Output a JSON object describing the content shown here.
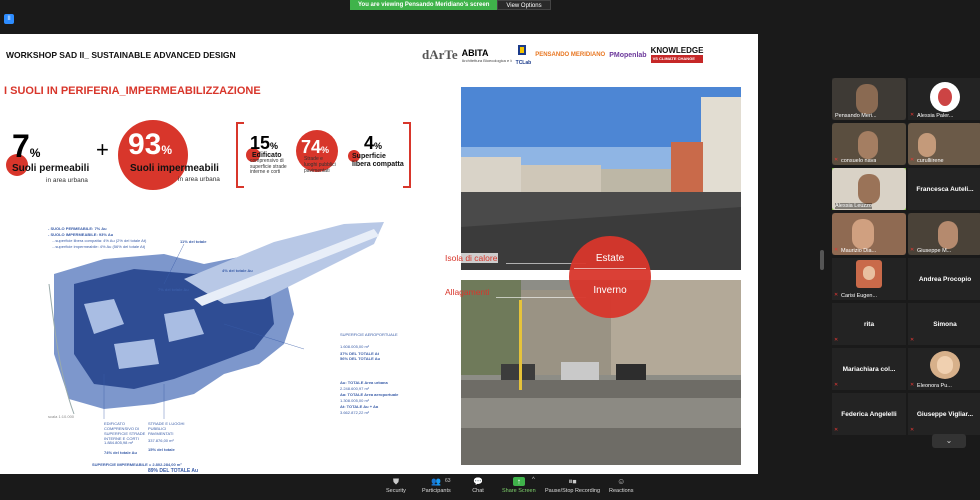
{
  "banner": {
    "viewing": "You are viewing Pensando Meridiano's screen",
    "view_options": "View Options"
  },
  "slide": {
    "workshop_title": "WORKSHOP SAD II_ SUSTAINABLE ADVANCED DESIGN",
    "logos": {
      "darte": "dArTe",
      "abita": "ABITA",
      "abita_sub": "Architettura Bioecologica e Innovazione Tecnologica per l'Ambiente",
      "tclab": "TCLab",
      "pensando": "PENSANDO MERIDIANO",
      "pmlab": "PMopenlab",
      "knowledge": "KNOWLEDGE",
      "knowledge_sub": "VS CLIMATE CHANGE"
    },
    "section_title": "I SUOLI IN PERIFERIA_IMPERMEABILIZZAZIONE",
    "stats": [
      {
        "value": "7",
        "unit": "%",
        "label": "Suoli permeabili",
        "sub": "in area urbana"
      },
      {
        "value": "93",
        "unit": "%",
        "label": "Suoli impermeabili",
        "sub": "in area urbana"
      },
      {
        "value": "15",
        "unit": "%",
        "label": "Edificato",
        "sub": "comprensivo di superficie strade interne e corti"
      },
      {
        "value": "74",
        "unit": "%",
        "label": "Strade e luoghi pubblici",
        "sub": "pavimentati"
      },
      {
        "value": "4",
        "unit": "%",
        "label": "Superficie",
        "sub": "libera compatta"
      }
    ],
    "plus": "+",
    "map_notes": {
      "permeabile": "- SUOLO PERMEABILE: 7% Au",
      "impermeabile": "- SUOLO IMPERMEABILE: 93% Au",
      "libera": "...superficie libera compatta: 4% Au (2% del totale At)",
      "imperm": "...superficie impermeabile: 4% Au (56% del totale At)",
      "tot11": "11% del totale",
      "tot7": "7% del totale Au",
      "tot4": "4% del totale Au",
      "aero": "SUPERFICIE AEROPORTUALE",
      "aero_val": "1.608.005,00 m²",
      "aero_pct": "37% DEL TOTALE At",
      "aero_pct2": "56% DEL TOTALE Au",
      "au_tot": "Au: TOTALE Area urbana",
      "au_val": "2.248.600,97 m²",
      "aa_tot": "Aa: TOTALE Area aeroportuale",
      "aa_val": "1.308.005,00 m²",
      "at_tot": "At: TOTALE Au + Aa",
      "at_val": "3.662.872,22 m²",
      "edif": "EDIFICATO COMPRENSIVO DI SUPERFICIE STRADE INTERNE E CORTI",
      "edif_val": "1.884.805,98 m²",
      "edif_pct": "74% del totale Au",
      "strade": "STRADE E LUOGHI PUBBLICI PAVIMENTATI",
      "strade_val": "337.876,00 m²",
      "strade_pct": "15% del totale",
      "sup_imperm": "SUPERFICIE IMPERMEABILE = 2.802.284,00 m²",
      "sup_pct": "89% DEL TOTALE Au",
      "scale": "scala 1:10.000"
    },
    "annotations": {
      "calore": "Isola di calore",
      "allagamenti": "Allagamenti"
    },
    "seasons": {
      "estate": "Estate",
      "inverno": "Inverno"
    }
  },
  "participants": [
    {
      "name": "Pensando Meri...",
      "type": "video"
    },
    {
      "name": "Alessia Paler...",
      "type": "video"
    },
    {
      "name": "consuelo nava",
      "type": "video"
    },
    {
      "name": "curulliirene",
      "type": "video"
    },
    {
      "name": "Alessia Leuzzo",
      "type": "video",
      "active": true
    },
    {
      "name": "Francesca Auteli...",
      "type": "name"
    },
    {
      "name": "Maurizio Dia...",
      "type": "video"
    },
    {
      "name": "Giuseppe M...",
      "type": "video"
    },
    {
      "name": "Carisi Eugen...",
      "type": "video"
    },
    {
      "name": "Andrea Procopio",
      "type": "name"
    },
    {
      "name": "rita",
      "type": "name"
    },
    {
      "name": "Simona",
      "type": "name"
    },
    {
      "name": "Mariachiara col...",
      "type": "name"
    },
    {
      "name": "Eleonora Pu...",
      "type": "video"
    },
    {
      "name": "Federica Angelelli",
      "type": "name"
    },
    {
      "name": "Giuseppe Vigliar...",
      "type": "name"
    }
  ],
  "toolbar": {
    "security": "Security",
    "participants": "Participants",
    "participants_count": "63",
    "chat": "Chat",
    "share": "Share Screen",
    "recording": "Pause/Stop Recording",
    "reactions": "Reactions"
  },
  "colors": {
    "accent_red": "#d8362b",
    "zoom_green": "#3fb34a",
    "map_blue": "#3a5da8"
  }
}
